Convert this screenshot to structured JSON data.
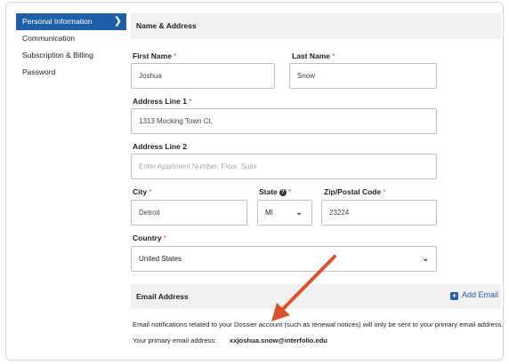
{
  "sidebar": {
    "items": [
      {
        "label": "Personal Information",
        "active": true
      },
      {
        "label": "Communication"
      },
      {
        "label": "Subscription & Billing"
      },
      {
        "label": "Password"
      }
    ]
  },
  "name_section": {
    "title": "Name & Address",
    "first_name": {
      "label": "First Name",
      "value": "Joshua"
    },
    "last_name": {
      "label": "Last Name",
      "value": "Snow"
    },
    "address1": {
      "label": "Address Line 1",
      "value": "1313 Mocking Town Ct."
    },
    "address2": {
      "label": "Address Line 2",
      "placeholder": "Enter Apartment Number, Floor, Suite",
      "value": ""
    },
    "city": {
      "label": "City",
      "value": "Detroit"
    },
    "state": {
      "label": "State",
      "value": "MI"
    },
    "zip": {
      "label": "Zip/Postal Code",
      "value": "23224"
    },
    "country": {
      "label": "Country",
      "value": "United States"
    }
  },
  "email_section": {
    "title": "Email Address",
    "add_label": "Add Email",
    "notice": "Email notifications related to your Dossier account (such as renewal notices) will only be sent to your primary email address.",
    "primary_label": "Your primary email address:",
    "primary_value": "xxjoshua.snow@interfolio.edu"
  },
  "colors": {
    "accent": "#1f5fa8",
    "required": "#d9534f",
    "annotation_arrow": "#d9532c"
  },
  "icons": {
    "active_chevron": "chevron-right-icon",
    "state_help": "question-circle-icon",
    "select_caret": "chevron-down-icon",
    "add": "plus-square-icon"
  }
}
